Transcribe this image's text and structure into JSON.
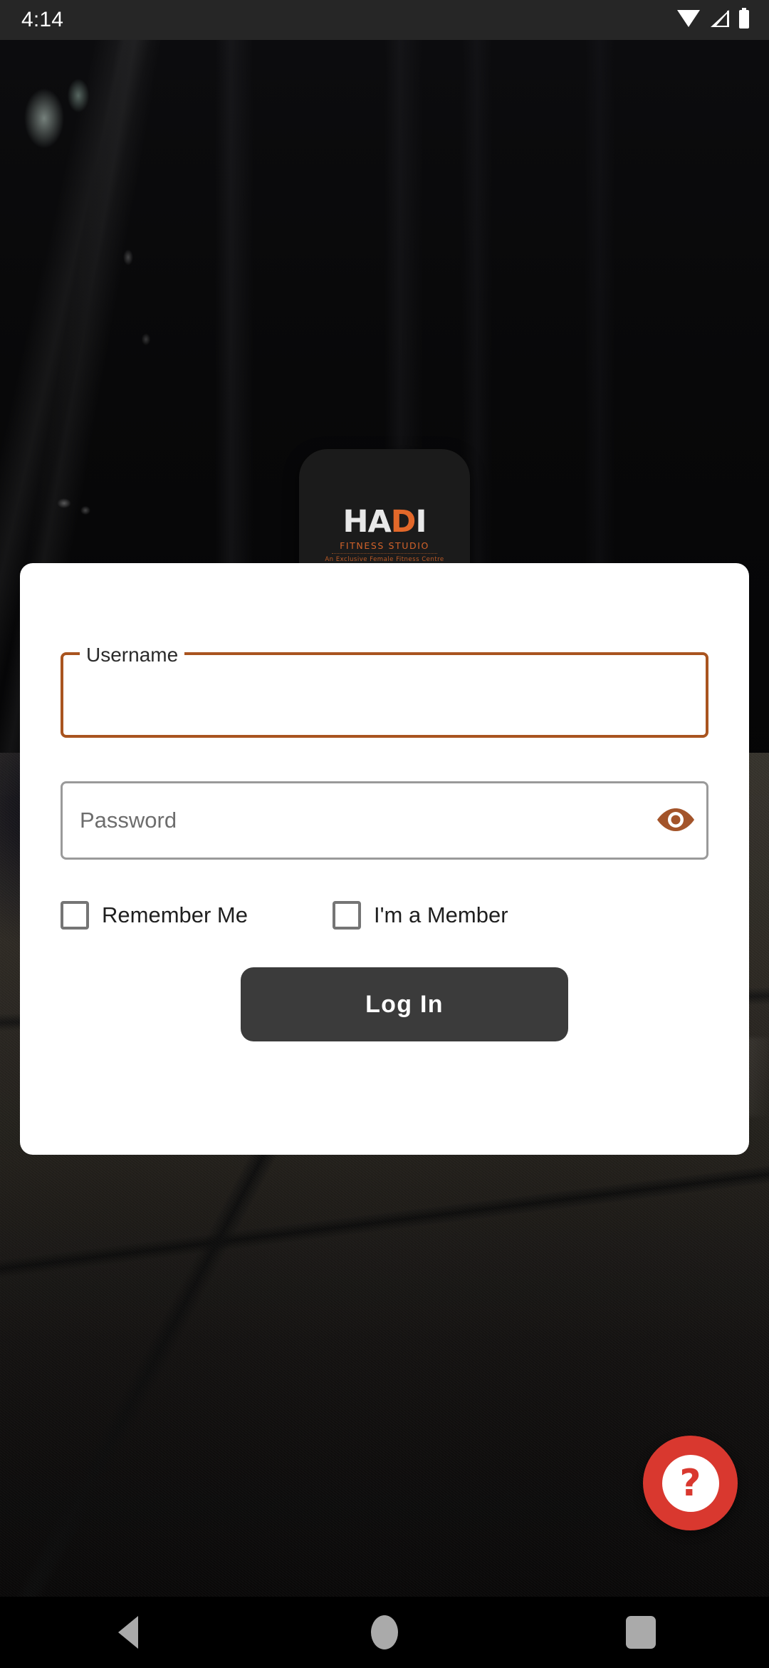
{
  "status_bar": {
    "time": "4:14",
    "icons": [
      "wifi-icon",
      "cellular-signal-icon",
      "battery-icon"
    ]
  },
  "logo": {
    "word_light": "HA",
    "word_accent": "D",
    "word_light_2": "I",
    "subtitle": "FITNESS STUDIO",
    "tagline": "An Exclusive Female Fitness Centre",
    "card_color": "#1b1b1b",
    "accent_color": "#e2682a"
  },
  "login_form": {
    "username": {
      "label": "Username",
      "value": "",
      "placeholder": "",
      "border_color": "#a9541f",
      "state": "focused"
    },
    "password": {
      "label": "Password",
      "value": "",
      "placeholder": "Password",
      "border_color": "#9a9a9a",
      "state": "default",
      "toggle_icon": "eye-icon",
      "toggle_color": "#a3542a"
    },
    "checkboxes": [
      {
        "label": "Remember Me",
        "checked": false
      },
      {
        "label": "I'm a Member",
        "checked": false
      }
    ],
    "submit": {
      "label": "Log In",
      "background": "#3b3b3b",
      "text_color": "#ffffff"
    }
  },
  "help_fab": {
    "icon": "question-mark-icon",
    "glyph": "?",
    "background": "#d9382f",
    "foreground": "#ffffff"
  },
  "nav_bar": {
    "back": "back-triangle-icon",
    "home": "home-circle-icon",
    "recents": "recents-square-icon"
  }
}
